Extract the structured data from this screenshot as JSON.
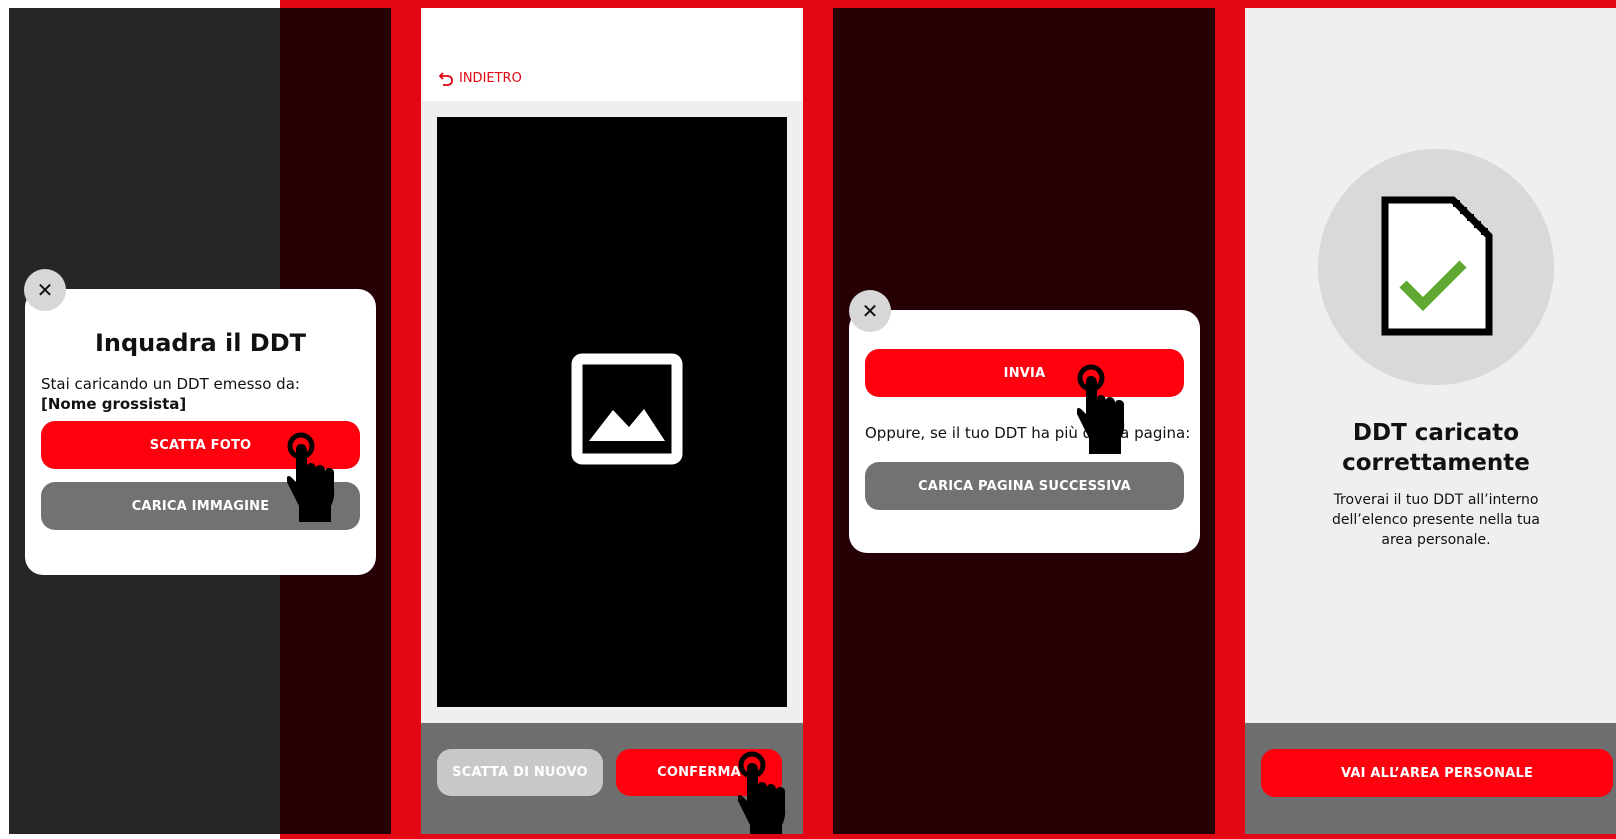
{
  "screen1": {
    "title": "Inquadra il DDT",
    "line1": "Stai caricando un DDT emesso da:",
    "line2": "[Nome grossista]",
    "scatta_label": "SCATTA FOTO",
    "carica_label": "CARICA IMMAGINE",
    "close_glyph": "✕"
  },
  "screen2": {
    "back_label": "INDIETRO",
    "retake_label": "SCATTA DI NUOVO",
    "confirm_label": "CONFERMA"
  },
  "screen3": {
    "send_label": "INVIA",
    "text": "Oppure, se il tuo DDT ha più di una pagina:",
    "next_page_label": "CARICA PAGINA SUCCESSIVA",
    "close_glyph": "✕"
  },
  "screen4": {
    "title_line1": "DDT caricato",
    "title_line2": "correttamente",
    "subtitle": "Troverai il tuo DDT all’interno dell’elenco presente nella tua area personale.",
    "button_label": "VAI ALL’AREA PERSONALE"
  },
  "colors": {
    "brand_red": "#e30613",
    "button_red": "#ff000f",
    "button_gray": "#727272",
    "dark_overlay": "#250005",
    "check_green": "#5fa832"
  },
  "icons": [
    "close-icon",
    "hand-pointer-icon",
    "back-arrow-icon",
    "image-placeholder-icon",
    "document-check-icon"
  ]
}
